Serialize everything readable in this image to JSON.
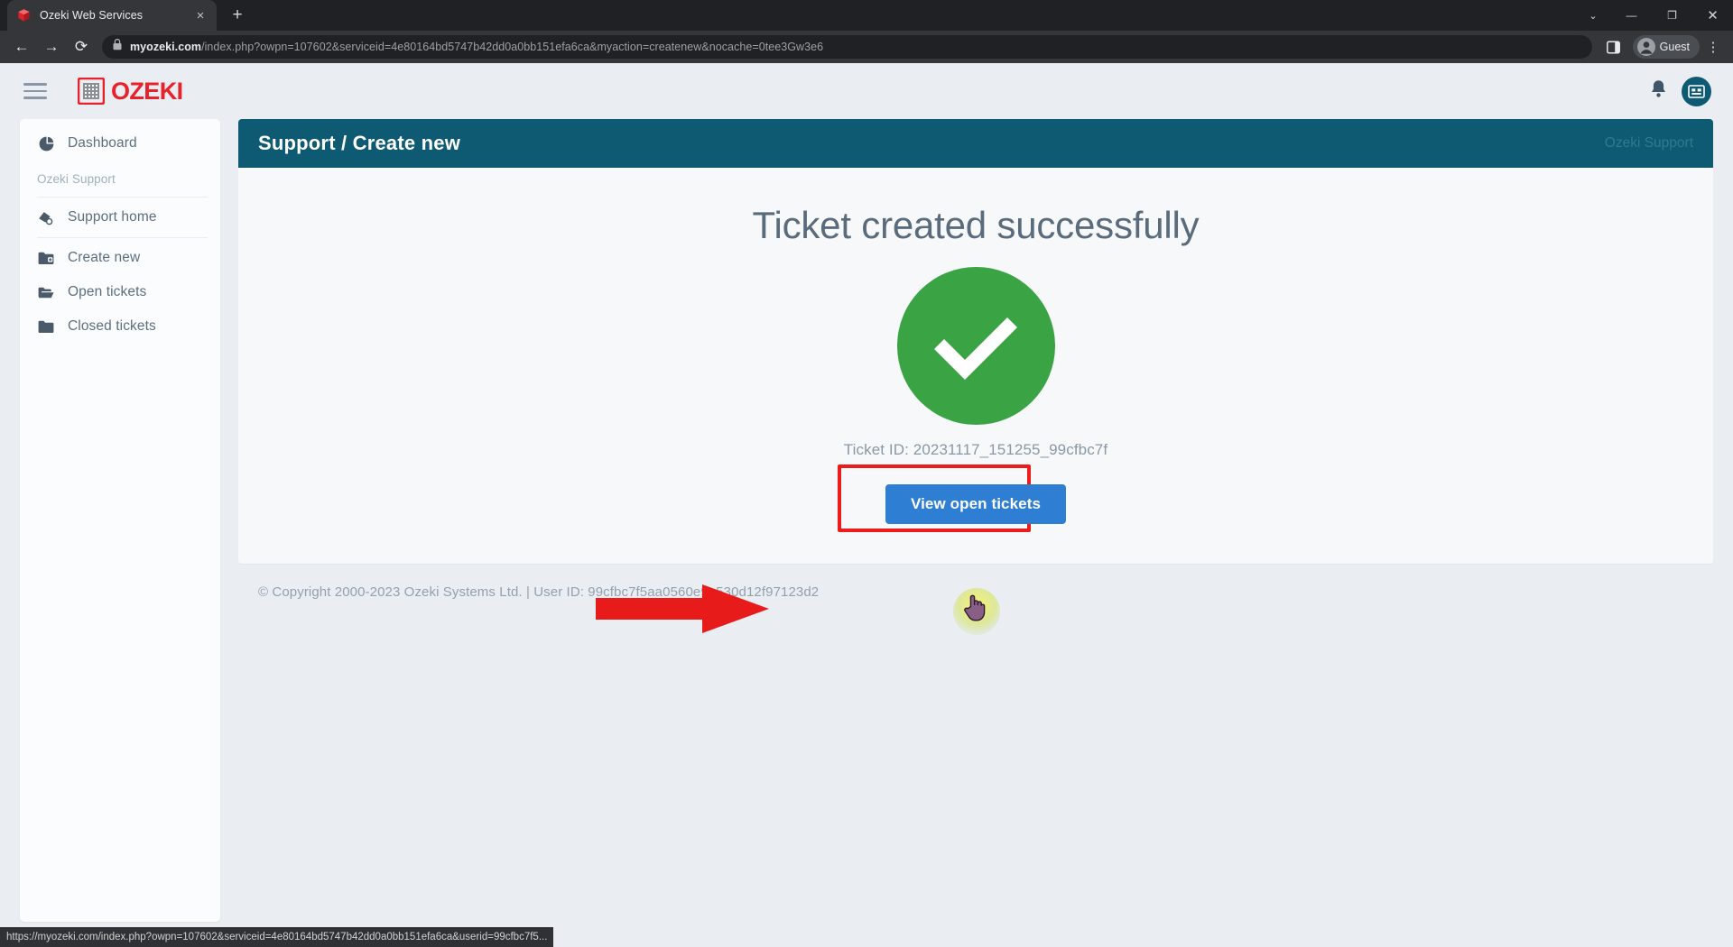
{
  "browser": {
    "tab": {
      "title": "Ozeki Web Services",
      "favicon_name": "ozeki-cube-favicon",
      "close_label": "×"
    },
    "newtab_label": "+",
    "window_controls": {
      "chevron": "⌄",
      "minimize": "—",
      "maximize": "❐",
      "close": "✕"
    },
    "nav": {
      "back": "←",
      "forward": "→",
      "reload": "⟳"
    },
    "omnibox": {
      "lock_icon": "lock-icon",
      "host": "myozeki.com",
      "path": "/index.php?owpn=107602&serviceid=4e80164bd5747b42dd0a0bb151efa6ca&myaction=createnew&nocache=0tee3Gw3e6",
      "full_url": "myozeki.com/index.php?owpn=107602&serviceid=4e80164bd5747b42dd0a0bb151efa6ca&myaction=createnew&nocache=0tee3Gw3e6"
    },
    "toolbar_right": {
      "side_panel_icon": "side-panel-icon",
      "profile_label": "Guest",
      "kebab_label": "⋮"
    },
    "status_bar_url": "https://myozeki.com/index.php?owpn=107602&serviceid=4e80164bd5747b42dd0a0bb151efa6ca&userid=99cfbc7f5..."
  },
  "appbar": {
    "menu_icon": "hamburger-menu-icon",
    "brand_text": "OZEKI",
    "brand_color": "#e8212b",
    "bell_icon": "notification-bell-icon",
    "avatar_icon": "user-avatar-icon"
  },
  "sidebar": {
    "items": [
      {
        "label": "Dashboard",
        "icon": "pie-chart-icon"
      }
    ],
    "group_label": "Ozeki Support",
    "group_items": [
      {
        "label": "Support home",
        "icon": "support-home-icon"
      },
      {
        "label": "Create new",
        "icon": "folder-plus-icon"
      },
      {
        "label": "Open tickets",
        "icon": "folder-open-icon"
      },
      {
        "label": "Closed tickets",
        "icon": "folder-closed-icon"
      }
    ]
  },
  "panel": {
    "title": "Support / Create new",
    "right_label": "Ozeki Support",
    "header_color": "#0d5a72"
  },
  "content": {
    "success_title": "Ticket created successfully",
    "check_icon": "green-check-circle-icon",
    "check_color": "#3aa343",
    "ticket_id": "Ticket ID: 20231117_151255_99cfbc7f",
    "button_label": "View open tickets",
    "button_color": "#2e7fd4",
    "annotation_box_color": "#ee1b1b",
    "arrow_icon": "red-arrow-pointer",
    "cursor_icon": "hand-pointer-cursor"
  },
  "footer": {
    "text": "© Copyright 2000-2023 Ozeki Systems Ltd.  |  User ID: 99cfbc7f5aa0560e9a530d12f97123d2"
  }
}
